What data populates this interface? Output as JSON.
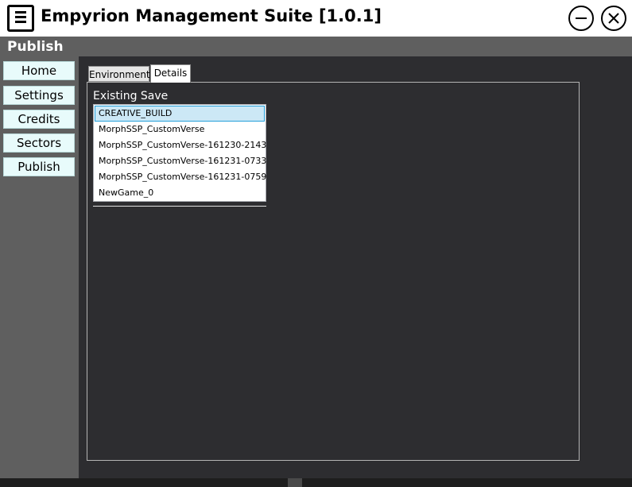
{
  "window": {
    "title": "Empyrion Management Suite [1.0.1]",
    "minimize_icon": "minimize-circle-icon",
    "close_icon": "close-circle-icon",
    "app_icon": "menu-document-icon"
  },
  "header": {
    "section_title": "Publish"
  },
  "sidebar": {
    "items": [
      {
        "label": "Home"
      },
      {
        "label": "Settings"
      },
      {
        "label": "Credits"
      },
      {
        "label": "Sectors"
      },
      {
        "label": "Publish"
      }
    ]
  },
  "tabs": [
    {
      "label": "Environment",
      "active": false
    },
    {
      "label": "Details",
      "active": true
    }
  ],
  "details": {
    "existing_save_label": "Existing Save",
    "saves": [
      {
        "name": "CREATIVE_BUILD",
        "selected": true
      },
      {
        "name": "MorphSSP_CustomVerse",
        "selected": false
      },
      {
        "name": "MorphSSP_CustomVerse-161230-2143",
        "selected": false
      },
      {
        "name": "MorphSSP_CustomVerse-161231-0733",
        "selected": false
      },
      {
        "name": "MorphSSP_CustomVerse-161231-0759",
        "selected": false
      },
      {
        "name": "NewGame_0",
        "selected": false
      }
    ]
  },
  "colors": {
    "background": "#2d2d30",
    "sidebar": "#5f5f5f",
    "nav_button": "#e8fbfb",
    "selection": "#cce8f6",
    "selection_border": "#26a0da"
  }
}
